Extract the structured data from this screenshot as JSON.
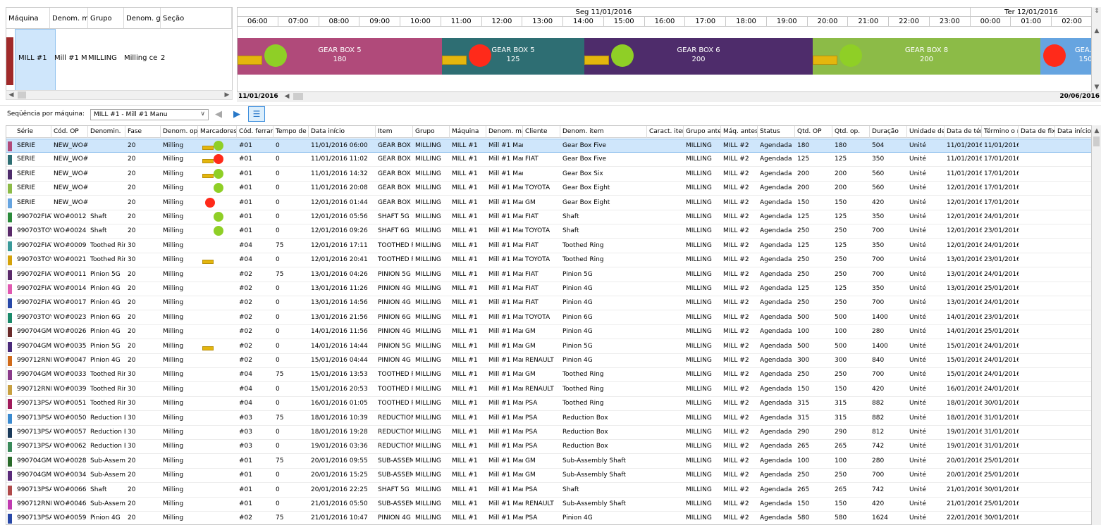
{
  "machine_panel": {
    "headers": [
      "Máquina",
      "Denom. m",
      "Grupo",
      "Denom. g",
      "Seção"
    ],
    "row": {
      "machine": "MILL #1",
      "denom": "Mill #1 M",
      "group": "MILLING",
      "group_denom": "Milling ce",
      "section": "2",
      "color": "#a02a2a"
    }
  },
  "gantt": {
    "dates": [
      "Seg 11/01/2016",
      "Ter 12/01/2016"
    ],
    "hours": [
      "06:00",
      "07:00",
      "08:00",
      "09:00",
      "10:00",
      "11:00",
      "12:00",
      "13:00",
      "14:00",
      "15:00",
      "16:00",
      "17:00",
      "18:00",
      "19:00",
      "20:00",
      "21:00",
      "22:00",
      "23:00",
      "00:00",
      "01:00",
      "02:00"
    ],
    "bars": [
      {
        "name": "GEAR BOX 5",
        "qty": "180",
        "color": "#b04a7a",
        "status_color": "#8fcf26"
      },
      {
        "name": "GEAR BOX 5",
        "qty": "125",
        "color": "#2e6e73",
        "status_color": "#ff2a1a"
      },
      {
        "name": "GEAR BOX 6",
        "qty": "200",
        "color": "#4e2c6b",
        "status_color": "#8fcf26"
      },
      {
        "name": "GEAR BOX 8",
        "qty": "200",
        "color": "#8cbb47",
        "status_color": "#8fcf26"
      },
      {
        "name": "GEA...",
        "qty": "150",
        "color": "#66a4e0",
        "status_color": "#ff2a1a"
      }
    ],
    "scroll_start": "11/01/2016",
    "scroll_end": "20/06/2016"
  },
  "toolbar": {
    "sequence_label": "Seqüência por máquina:",
    "sequence_value": "MILL #1 - Mill #1 Manu"
  },
  "grid": {
    "headers": [
      "Série",
      "Cód. OP",
      "Denomin.",
      "Fase",
      "Denom. ope",
      "Marcadores",
      "Cód. ferram",
      "Tempo de tr",
      "Data início",
      "Item",
      "Grupo",
      "Máquina",
      "Denom. máq",
      "Cliente",
      "Denom. item",
      "Caract. item",
      "Grupo antes",
      "Máq. antes",
      "Status",
      "Qtd. OP",
      "Qtd. op.",
      "Duração",
      "Unidade de",
      "Data de térm",
      "Término o m",
      "Data de fixa",
      "Data início"
    ],
    "rows": [
      {
        "color": "#b04a7a",
        "m": "rg",
        "c": [
          "SERIE",
          "NEW_WO#(",
          "",
          "20",
          "Milling",
          "",
          "#01",
          "0",
          "11/01/2016 06:00",
          "GEAR BOX 5",
          "MILLING",
          "MILL #1",
          "Mill #1 Manu",
          "",
          "Gear Box Five",
          "",
          "MILLING",
          "MILL #2",
          "Agendada",
          "180",
          "180",
          "504",
          "Unité",
          "11/01/2016",
          "11/01/2016",
          "",
          ""
        ]
      },
      {
        "color": "#2e6e73",
        "m": "rr",
        "c": [
          "SERIE",
          "NEW_WO#(",
          "",
          "20",
          "Milling",
          "",
          "#01",
          "0",
          "11/01/2016 11:02",
          "GEAR BOX 5",
          "MILLING",
          "MILL #1",
          "Mill #1 Manu",
          "FIAT",
          "Gear Box Five",
          "",
          "MILLING",
          "MILL #2",
          "Agendada",
          "125",
          "125",
          "350",
          "Unité",
          "11/01/2016",
          "17/01/2016",
          "",
          ""
        ]
      },
      {
        "color": "#4e2c6b",
        "m": "rg",
        "c": [
          "SERIE",
          "NEW_WO#(",
          "",
          "20",
          "Milling",
          "",
          "#01",
          "0",
          "11/01/2016 14:32",
          "GEAR BOX 6",
          "MILLING",
          "MILL #1",
          "Mill #1 Manu",
          "",
          "Gear Box Six",
          "",
          "MILLING",
          "MILL #2",
          "Agendada",
          "200",
          "200",
          "560",
          "Unité",
          "11/01/2016",
          "17/01/2016",
          "",
          ""
        ]
      },
      {
        "color": "#8cbb47",
        "m": "g",
        "c": [
          "SERIE",
          "NEW_WO#(",
          "",
          "20",
          "Milling",
          "",
          "#01",
          "0",
          "11/01/2016 20:08",
          "GEAR BOX 8",
          "MILLING",
          "MILL #1",
          "Mill #1 Manu",
          "TOYOTA",
          "Gear Box Eight",
          "",
          "MILLING",
          "MILL #2",
          "Agendada",
          "200",
          "200",
          "560",
          "Unité",
          "12/01/2016",
          "17/01/2016",
          "",
          ""
        ]
      },
      {
        "color": "#66a4e0",
        "m": "r",
        "c": [
          "SERIE",
          "NEW_WO#(",
          "",
          "20",
          "Milling",
          "",
          "#01",
          "0",
          "12/01/2016 01:44",
          "GEAR BOX 8",
          "MILLING",
          "MILL #1",
          "Mill #1 Manu",
          "GM",
          "Gear Box Eight",
          "",
          "MILLING",
          "MILL #2",
          "Agendada",
          "150",
          "150",
          "420",
          "Unité",
          "12/01/2016",
          "17/01/2016",
          "",
          ""
        ]
      },
      {
        "color": "#2a8a3a",
        "m": "g",
        "c": [
          "990702FIAT",
          "WO#0012",
          "Shaft",
          "20",
          "Milling",
          "",
          "#01",
          "0",
          "12/01/2016 05:56",
          "SHAFT 5G",
          "MILLING",
          "MILL #1",
          "Mill #1 Manu",
          "FIAT",
          "Shaft",
          "",
          "MILLING",
          "MILL #2",
          "Agendada",
          "125",
          "125",
          "350",
          "Unité",
          "12/01/2016",
          "24/01/2016",
          "",
          ""
        ]
      },
      {
        "color": "#5a2a6a",
        "m": "g",
        "c": [
          "990703TOY(",
          "WO#0024",
          "Shaft",
          "20",
          "Milling",
          "",
          "#01",
          "0",
          "12/01/2016 09:26",
          "SHAFT 6G",
          "MILLING",
          "MILL #1",
          "Mill #1 Manu",
          "TOYOTA",
          "Shaft",
          "",
          "MILLING",
          "MILL #2",
          "Agendada",
          "250",
          "250",
          "700",
          "Unité",
          "12/01/2016",
          "23/01/2016",
          "",
          ""
        ]
      },
      {
        "color": "#3a9a9a",
        "m": "",
        "c": [
          "990702FIAT",
          "WO#0009",
          "Toothed Rin",
          "30",
          "Milling",
          "",
          "#04",
          "75",
          "12/01/2016 17:11",
          "TOOTHED R",
          "MILLING",
          "MILL #1",
          "Mill #1 Manu",
          "FIAT",
          "Toothed Ring",
          "",
          "MILLING",
          "MILL #2",
          "Agendada",
          "125",
          "125",
          "350",
          "Unité",
          "12/01/2016",
          "24/01/2016",
          "",
          ""
        ]
      },
      {
        "color": "#d4a20a",
        "m": "y",
        "c": [
          "990703TOY(",
          "WO#0021",
          "Toothed Rin",
          "30",
          "Milling",
          "",
          "#04",
          "0",
          "12/01/2016 20:41",
          "TOOTHED R",
          "MILLING",
          "MILL #1",
          "Mill #1 Manu",
          "TOYOTA",
          "Toothed Ring",
          "",
          "MILLING",
          "MILL #2",
          "Agendada",
          "250",
          "250",
          "700",
          "Unité",
          "13/01/2016",
          "23/01/2016",
          "",
          ""
        ]
      },
      {
        "color": "#5a2a6a",
        "m": "",
        "c": [
          "990702FIAT",
          "WO#0011",
          "Pinion 5G",
          "20",
          "Milling",
          "",
          "#02",
          "75",
          "13/01/2016 04:26",
          "PINION 5G",
          "MILLING",
          "MILL #1",
          "Mill #1 Manu",
          "FIAT",
          "Pinion 5G",
          "",
          "MILLING",
          "MILL #2",
          "Agendada",
          "250",
          "250",
          "700",
          "Unité",
          "13/01/2016",
          "24/01/2016",
          "",
          ""
        ]
      },
      {
        "color": "#e058b0",
        "m": "",
        "c": [
          "990702FIAT",
          "WO#0014",
          "Pinion 4G",
          "20",
          "Milling",
          "",
          "#02",
          "0",
          "13/01/2016 11:26",
          "PINION 4G",
          "MILLING",
          "MILL #1",
          "Mill #1 Manu",
          "FIAT",
          "Pinion 4G",
          "",
          "MILLING",
          "MILL #2",
          "Agendada",
          "125",
          "125",
          "350",
          "Unité",
          "13/01/2016",
          "25/01/2016",
          "",
          ""
        ]
      },
      {
        "color": "#2848a8",
        "m": "",
        "c": [
          "990702FIAT",
          "WO#0017",
          "Pinion 4G",
          "20",
          "Milling",
          "",
          "#02",
          "0",
          "13/01/2016 14:56",
          "PINION 4G",
          "MILLING",
          "MILL #1",
          "Mill #1 Manu",
          "FIAT",
          "Pinion 4G",
          "",
          "MILLING",
          "MILL #2",
          "Agendada",
          "250",
          "250",
          "700",
          "Unité",
          "13/01/2016",
          "24/01/2016",
          "",
          ""
        ]
      },
      {
        "color": "#1a8a6a",
        "m": "",
        "c": [
          "990703TOY(",
          "WO#0023",
          "Pinion 6G",
          "20",
          "Milling",
          "",
          "#02",
          "0",
          "13/01/2016 21:56",
          "PINION 6G",
          "MILLING",
          "MILL #1",
          "Mill #1 Manu",
          "TOYOTA",
          "Pinion 6G",
          "",
          "MILLING",
          "MILL #2",
          "Agendada",
          "500",
          "500",
          "1400",
          "Unité",
          "14/01/2016",
          "23/01/2016",
          "",
          ""
        ]
      },
      {
        "color": "#6a2a2a",
        "m": "",
        "c": [
          "990704GM",
          "WO#0026",
          "Pinion 4G",
          "20",
          "Milling",
          "",
          "#02",
          "0",
          "14/01/2016 11:56",
          "PINION 4G",
          "MILLING",
          "MILL #1",
          "Mill #1 Manu",
          "GM",
          "Pinion 4G",
          "",
          "MILLING",
          "MILL #2",
          "Agendada",
          "100",
          "100",
          "280",
          "Unité",
          "14/01/2016",
          "25/01/2016",
          "",
          ""
        ]
      },
      {
        "color": "#4a2a7a",
        "m": "y",
        "c": [
          "990704GM",
          "WO#0035",
          "Pinion 5G",
          "20",
          "Milling",
          "",
          "#02",
          "0",
          "14/01/2016 14:44",
          "PINION 5G",
          "MILLING",
          "MILL #1",
          "Mill #1 Manu",
          "GM",
          "Pinion 5G",
          "",
          "MILLING",
          "MILL #2",
          "Agendada",
          "500",
          "500",
          "1400",
          "Unité",
          "15/01/2016",
          "24/01/2016",
          "",
          ""
        ]
      },
      {
        "color": "#d06a1a",
        "m": "",
        "c": [
          "990712RNLT",
          "WO#0047",
          "Pinion 4G",
          "20",
          "Milling",
          "",
          "#02",
          "0",
          "15/01/2016 04:44",
          "PINION 4G",
          "MILLING",
          "MILL #1",
          "Mill #1 Manu",
          "RENAULT",
          "Pinion 4G",
          "",
          "MILLING",
          "MILL #2",
          "Agendada",
          "300",
          "300",
          "840",
          "Unité",
          "15/01/2016",
          "24/01/2016",
          "",
          ""
        ]
      },
      {
        "color": "#8a3a8a",
        "m": "",
        "c": [
          "990704GM",
          "WO#0033",
          "Toothed Rin",
          "30",
          "Milling",
          "",
          "#04",
          "75",
          "15/01/2016 13:53",
          "TOOTHED R",
          "MILLING",
          "MILL #1",
          "Mill #1 Manu",
          "GM",
          "Toothed Ring",
          "",
          "MILLING",
          "MILL #2",
          "Agendada",
          "250",
          "250",
          "700",
          "Unité",
          "15/01/2016",
          "24/01/2016",
          "",
          ""
        ]
      },
      {
        "color": "#c8a040",
        "m": "",
        "c": [
          "990712RNLT",
          "WO#0039",
          "Toothed Rin",
          "30",
          "Milling",
          "",
          "#04",
          "0",
          "15/01/2016 20:53",
          "TOOTHED R",
          "MILLING",
          "MILL #1",
          "Mill #1 Manu",
          "RENAULT",
          "Toothed Ring",
          "",
          "MILLING",
          "MILL #2",
          "Agendada",
          "150",
          "150",
          "420",
          "Unité",
          "16/01/2016",
          "24/01/2016",
          "",
          ""
        ]
      },
      {
        "color": "#a01a5a",
        "m": "",
        "c": [
          "990713PSA",
          "WO#0051",
          "Toothed Rin",
          "30",
          "Milling",
          "",
          "#04",
          "0",
          "16/01/2016 01:05",
          "TOOTHED R",
          "MILLING",
          "MILL #1",
          "Mill #1 Manu",
          "PSA",
          "Toothed Ring",
          "",
          "MILLING",
          "MILL #2",
          "Agendada",
          "315",
          "315",
          "882",
          "Unité",
          "18/01/2016",
          "30/01/2016",
          "",
          ""
        ]
      },
      {
        "color": "#3a8ad0",
        "m": "",
        "c": [
          "990713PSA",
          "WO#0050",
          "Reduction B",
          "30",
          "Milling",
          "",
          "#03",
          "75",
          "18/01/2016 10:39",
          "REDUCTION",
          "MILLING",
          "MILL #1",
          "Mill #1 Manu",
          "PSA",
          "Reduction Box",
          "",
          "MILLING",
          "MILL #2",
          "Agendada",
          "315",
          "315",
          "882",
          "Unité",
          "18/01/2016",
          "31/01/2016",
          "",
          ""
        ]
      },
      {
        "color": "#1a3a5a",
        "m": "",
        "c": [
          "990713PSA",
          "WO#0057",
          "Reduction B",
          "30",
          "Milling",
          "",
          "#03",
          "0",
          "18/01/2016 19:28",
          "REDUCTION",
          "MILLING",
          "MILL #1",
          "Mill #1 Manu",
          "PSA",
          "Reduction Box",
          "",
          "MILLING",
          "MILL #2",
          "Agendada",
          "290",
          "290",
          "812",
          "Unité",
          "19/01/2016",
          "31/01/2016",
          "",
          ""
        ]
      },
      {
        "color": "#3a8a5a",
        "m": "",
        "c": [
          "990713PSA",
          "WO#0062",
          "Reduction B",
          "30",
          "Milling",
          "",
          "#03",
          "0",
          "19/01/2016 03:36",
          "REDUCTION",
          "MILLING",
          "MILL #1",
          "Mill #1 Manu",
          "PSA",
          "Reduction Box",
          "",
          "MILLING",
          "MILL #2",
          "Agendada",
          "265",
          "265",
          "742",
          "Unité",
          "19/01/2016",
          "31/01/2016",
          "",
          ""
        ]
      },
      {
        "color": "#2a6a2a",
        "m": "",
        "c": [
          "990704GM",
          "WO#0028",
          "Sub-Assemb",
          "20",
          "Milling",
          "",
          "#01",
          "75",
          "20/01/2016 09:55",
          "SUB-ASSEMI",
          "MILLING",
          "MILL #1",
          "Mill #1 Manu",
          "GM",
          "Sub-Assembly Shaft",
          "",
          "MILLING",
          "MILL #2",
          "Agendada",
          "100",
          "100",
          "280",
          "Unité",
          "20/01/2016",
          "25/01/2016",
          "",
          ""
        ]
      },
      {
        "color": "#5a2a7a",
        "m": "",
        "c": [
          "990704GM",
          "WO#0034",
          "Sub-Assemb",
          "20",
          "Milling",
          "",
          "#01",
          "0",
          "20/01/2016 15:25",
          "SUB-ASSEMI",
          "MILLING",
          "MILL #1",
          "Mill #1 Manu",
          "GM",
          "Sub-Assembly Shaft",
          "",
          "MILLING",
          "MILL #2",
          "Agendada",
          "250",
          "250",
          "700",
          "Unité",
          "20/01/2016",
          "25/01/2016",
          "",
          ""
        ]
      },
      {
        "color": "#b04a4a",
        "m": "",
        "c": [
          "990713PSA",
          "WO#0066",
          "Shaft",
          "20",
          "Milling",
          "",
          "#01",
          "0",
          "20/01/2016 22:25",
          "SHAFT 5G",
          "MILLING",
          "MILL #1",
          "Mill #1 Manu",
          "PSA",
          "Shaft",
          "",
          "MILLING",
          "MILL #2",
          "Agendada",
          "265",
          "265",
          "742",
          "Unité",
          "21/01/2016",
          "30/01/2016",
          "",
          ""
        ]
      },
      {
        "color": "#c03ab0",
        "m": "",
        "c": [
          "990712RNLT",
          "WO#0046",
          "Sub-Assemb",
          "20",
          "Milling",
          "",
          "#01",
          "0",
          "21/01/2016 05:50",
          "SUB-ASSEMI",
          "MILLING",
          "MILL #1",
          "Mill #1 Manu",
          "RENAULT",
          "Sub-Assembly Shaft",
          "",
          "MILLING",
          "MILL #2",
          "Agendada",
          "150",
          "150",
          "420",
          "Unité",
          "21/01/2016",
          "25/01/2016",
          "",
          ""
        ]
      },
      {
        "color": "#2848a8",
        "m": "",
        "c": [
          "990713PSA",
          "WO#0059",
          "Pinion 4G",
          "20",
          "Milling",
          "",
          "#02",
          "75",
          "21/01/2016 10:47",
          "PINION 4G",
          "MILLING",
          "MILL #1",
          "Mill #1 Manu",
          "PSA",
          "Pinion 4G",
          "",
          "MILLING",
          "MILL #2",
          "Agendada",
          "580",
          "580",
          "1624",
          "Unité",
          "22/01/2016",
          "30/01/2016",
          "",
          ""
        ]
      }
    ]
  }
}
